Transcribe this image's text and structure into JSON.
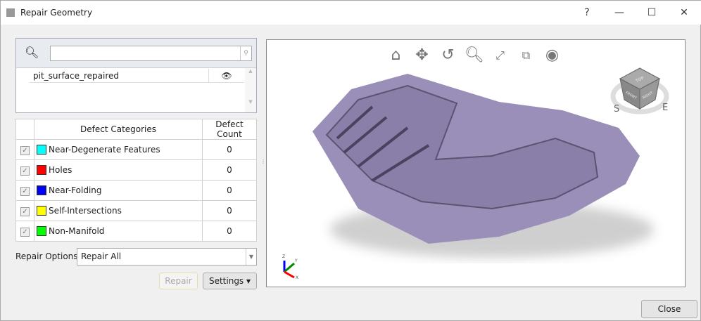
{
  "window": {
    "title": "Repair Geometry",
    "help": "?",
    "minimize": "—",
    "maximize": "☐",
    "close": "✕"
  },
  "layers": {
    "search_value": "",
    "items": [
      {
        "name": "pit_surface_repaired",
        "visible": true
      }
    ]
  },
  "defects": {
    "headers": [
      "Defect Categories",
      "Defect Count"
    ],
    "rows": [
      {
        "name": "Near-Degenerate Features",
        "color": "#00ffff",
        "count": "0",
        "checked": true
      },
      {
        "name": "Holes",
        "color": "#ff0000",
        "count": "0",
        "checked": true
      },
      {
        "name": "Near-Folding",
        "color": "#0000ff",
        "count": "0",
        "checked": true
      },
      {
        "name": "Self-Intersections",
        "color": "#ffff00",
        "count": "0",
        "checked": true
      },
      {
        "name": "Non-Manifold",
        "color": "#00ff00",
        "count": "0",
        "checked": true
      }
    ]
  },
  "repair_options": {
    "label": "Repair Options:",
    "value": "Repair All"
  },
  "buttons": {
    "repair": "Repair",
    "settings": "Settings ▾",
    "close": "Close"
  },
  "viewer": {
    "tools": [
      "home-icon",
      "pan-icon",
      "rotate-icon",
      "zoom-icon",
      "fit-icon",
      "zoom-window-icon",
      "visibility-icon"
    ],
    "cube": {
      "top": "TOP",
      "front": "FRONT",
      "right": "RIGHT",
      "south": "S",
      "east": "E"
    },
    "axes": {
      "x": "X",
      "y": "Y",
      "z": "Z"
    },
    "mesh_color": "#9a8fb8"
  }
}
